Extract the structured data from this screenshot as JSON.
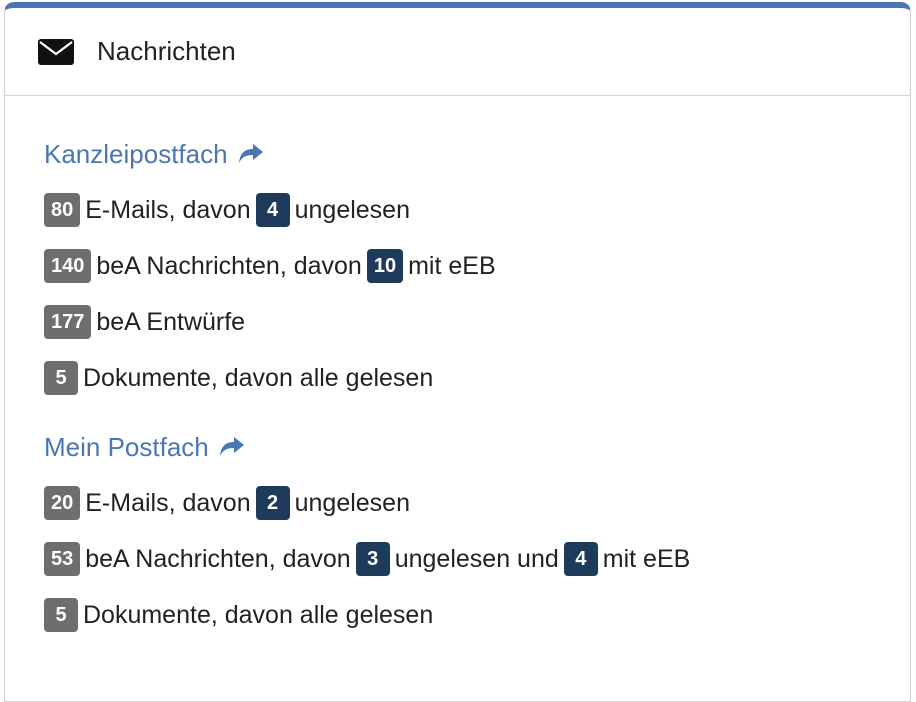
{
  "header": {
    "icon": "envelope-icon",
    "title": "Nachrichten"
  },
  "colors": {
    "accent": "#4a77b4",
    "badge_gray": "#6e6e6e",
    "badge_dark": "#1f3b5c"
  },
  "sections": [
    {
      "title": "Kanzleipostfach",
      "link_icon": "share-arrow-icon",
      "rows": [
        {
          "count": "80",
          "text1": "E-Mails, davon",
          "count2": "4",
          "text2": "ungelesen"
        },
        {
          "count": "140",
          "text1": "beA Nachrichten, davon",
          "count2": "10",
          "text2": "mit eEB"
        },
        {
          "count": "177",
          "text1": "beA Entwürfe"
        },
        {
          "count": "5",
          "text1": "Dokumente, davon alle gelesen"
        }
      ]
    },
    {
      "title": "Mein Postfach",
      "link_icon": "share-arrow-icon",
      "rows": [
        {
          "count": "20",
          "text1": "E-Mails, davon",
          "count2": "2",
          "text2": "ungelesen"
        },
        {
          "count": "53",
          "text1": "beA Nachrichten, davon",
          "count2": "3",
          "text2": "ungelesen und",
          "count3": "4",
          "text3": "mit eEB"
        },
        {
          "count": "5",
          "text1": "Dokumente, davon alle gelesen"
        }
      ]
    }
  ]
}
